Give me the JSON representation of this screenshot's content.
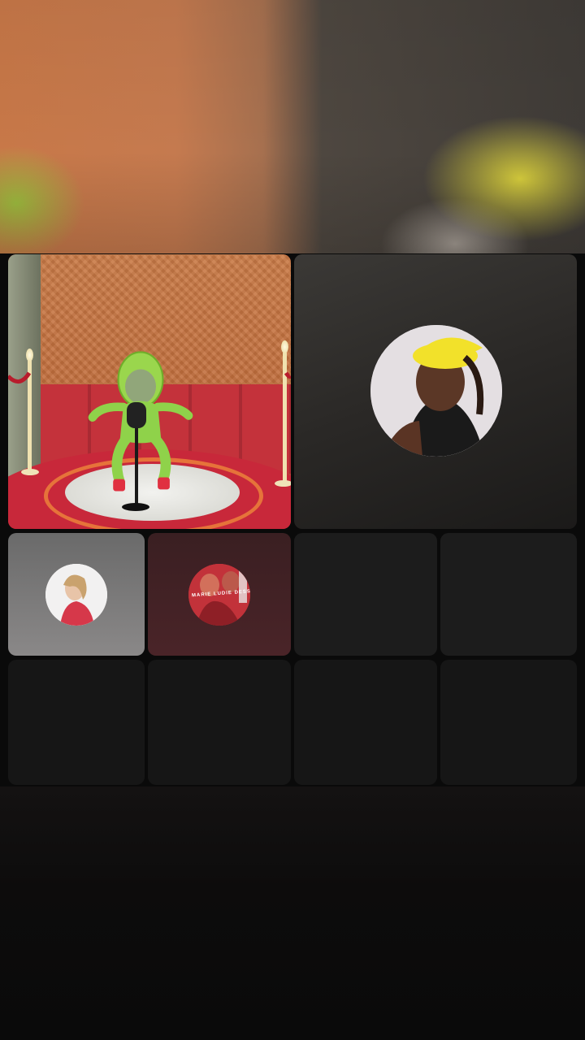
{
  "app": {
    "screen": "multi-guest live room"
  },
  "tiles": {
    "stage": {
      "kind": "animated-stage-avatar"
    },
    "guest_1": {
      "kind": "guest-camera-avatar"
    },
    "guest_2": {
      "kind": "guest-avatar"
    },
    "guest_3": {
      "kind": "guest-avatar",
      "avatar_text": "MARIE LUDIE DESSO"
    },
    "empty_slots": 6
  },
  "colors": {
    "backdrop_left": "#c87848",
    "backdrop_right": "#3f3b37",
    "stage_red": "#c8283a",
    "stage_wall": "#c97a46",
    "figure_green": "#8fd24a",
    "cap_yellow": "#f2e12a",
    "empty_tile": "#1c1c1c",
    "page_bg": "#0a0a0a"
  },
  "icons": {
    "stage_mic": "microphone-stand-icon"
  }
}
